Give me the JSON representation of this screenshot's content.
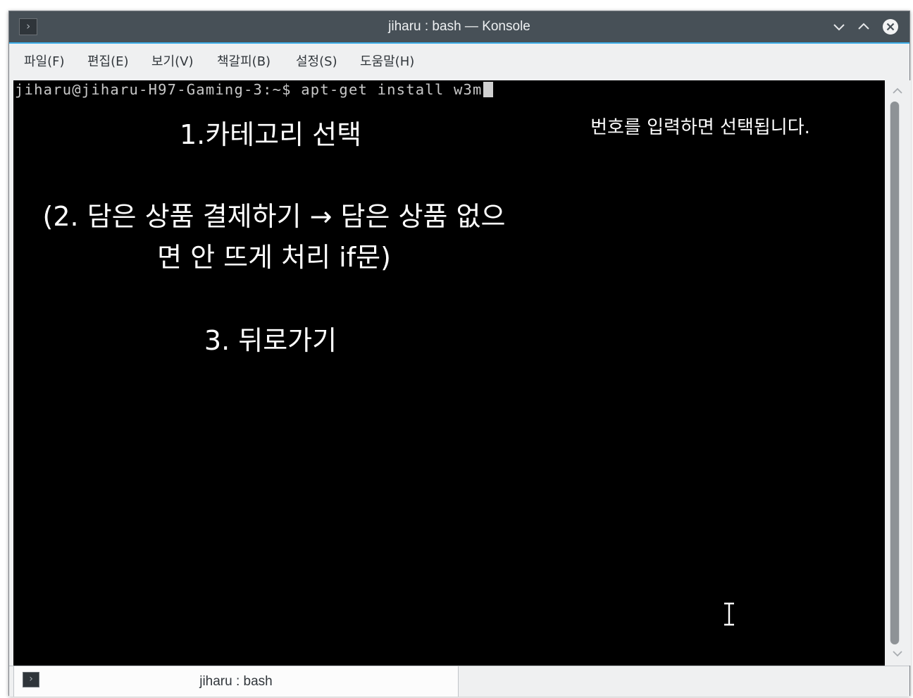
{
  "window": {
    "title": "jiharu : bash — Konsole",
    "app_icon_glyph": "›"
  },
  "menubar": {
    "items": [
      {
        "label": "파일(F)"
      },
      {
        "label": "편집(E)"
      },
      {
        "label": "보기(V)"
      },
      {
        "label": "책갈피(B)"
      },
      {
        "label": "설정(S)"
      },
      {
        "label": "도움말(H)"
      }
    ]
  },
  "terminal": {
    "prompt": "jiharu@jiharu-H97-Gaming-3:~$ ",
    "command": "apt-get install w3m"
  },
  "overlay": {
    "line1": "1.카테고리 선택",
    "line2": "(2. 담은 상품 결제하기 → 담은 상품 없으\n면 안 뜨게 처리 if문)",
    "line3": "3. 뒤로가기",
    "note": "번호를 입력하면 선택됩니다."
  },
  "tabbar": {
    "tab_label": "jiharu : bash",
    "tab_icon_glyph": "›"
  },
  "colors": {
    "titlebar": "#475057",
    "accent": "#3daee9",
    "terminal_bg": "#000000",
    "terminal_fg": "#c8c8c8"
  }
}
